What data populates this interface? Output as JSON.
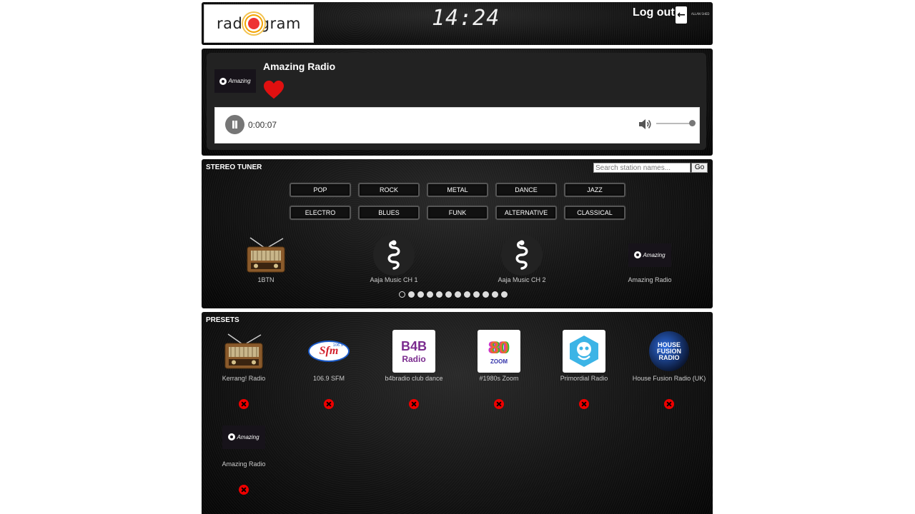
{
  "header": {
    "logo_text_left": "radi",
    "logo_text_right": "gram",
    "clock": "14:24",
    "logout_label": "Log out",
    "logout_icon": "arrow-left-icon",
    "tiny_text": "ALLAN SHED"
  },
  "player": {
    "station_name": "Amazing Radio",
    "station_logo_text": "Amazing",
    "favorite_icon": "heart-icon",
    "favorite_color": "#e01010",
    "elapsed": "0:00:07",
    "volume": 1.0
  },
  "tuner": {
    "title": "STEREO TUNER",
    "search_placeholder": "Search station names...",
    "go_label": "Go",
    "genres_row1": [
      "POP",
      "ROCK",
      "METAL",
      "DANCE",
      "JAZZ"
    ],
    "genres_row2": [
      "ELECTRO",
      "BLUES",
      "FUNK",
      "ALTERNATIVE",
      "CLASSICAL"
    ],
    "stations": [
      {
        "name": "1BTN",
        "icon": "vintage-radio-icon"
      },
      {
        "name": "Aaja Music CH 1",
        "icon": "snake-icon"
      },
      {
        "name": "Aaja Music CH 2",
        "icon": "snake-icon"
      },
      {
        "name": "Amazing Radio",
        "icon": "amazing-logo"
      }
    ],
    "page_count": 12,
    "active_page": 1
  },
  "presets": {
    "title": "PRESETS",
    "items": [
      {
        "name": "Kerrang! Radio",
        "logo": "vintage-radio-icon"
      },
      {
        "name": "106.9 SFM",
        "logo": "sfm-logo",
        "logo_text": "Sfm",
        "logo_sub": "106.9"
      },
      {
        "name": "b4bradio club dance",
        "logo": "b4b-logo",
        "logo_text": "B4B",
        "logo_sub": "Radio"
      },
      {
        "name": "#1980s Zoom",
        "logo": "80s-logo",
        "logo_text": "80",
        "logo_sub": "ZOOM"
      },
      {
        "name": "Primordial Radio",
        "logo": "primordial-logo"
      },
      {
        "name": "House Fusion Radio (UK)",
        "logo": "house-fusion-logo",
        "logo_text": "HOUSE FUSION RADIO"
      },
      {
        "name": "Amazing Radio",
        "logo": "amazing-logo",
        "logo_text": "Amazing"
      }
    ],
    "remove_icon": "remove-icon"
  }
}
